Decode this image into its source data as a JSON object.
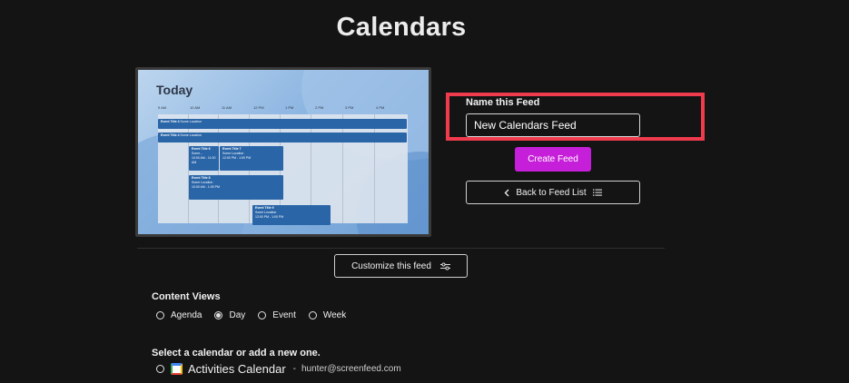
{
  "page": {
    "title": "Calendars"
  },
  "preview": {
    "heading": "Today",
    "hours": [
      "9 AM",
      "10 AM",
      "11 AM",
      "12 PM",
      "1 PM",
      "2 PM",
      "3 PM",
      "4 PM"
    ],
    "events": [
      {
        "title": "Event Title 3",
        "sub": "Some Location"
      },
      {
        "title": "Event Title 4",
        "sub": "Some Location"
      },
      {
        "title": "Event Title 6",
        "sub": "Some...",
        "time": "10:00 AM - 11:00 AM"
      },
      {
        "title": "Event Title 7",
        "sub": "Some Location",
        "time": "12:00 PM - 1:00 PM"
      },
      {
        "title": "Event Title 8",
        "sub": "Some Location",
        "time": "10:00 AM - 1:00 PM"
      },
      {
        "title": "Event Title 9",
        "sub": "Some Location",
        "time": "12:00 PM - 1:00 PM"
      }
    ]
  },
  "feed_form": {
    "name_label": "Name this Feed",
    "name_value": "New Calendars Feed",
    "create_label": "Create Feed",
    "back_label": "Back to Feed List"
  },
  "customize": {
    "label": "Customize this feed"
  },
  "content_views": {
    "label": "Content Views",
    "options": [
      {
        "label": "Agenda",
        "selected": false
      },
      {
        "label": "Day",
        "selected": true
      },
      {
        "label": "Event",
        "selected": false
      },
      {
        "label": "Week",
        "selected": false
      }
    ]
  },
  "calendar_select": {
    "label": "Select a calendar or add a new one.",
    "calendars": [
      {
        "name": "Activities Calendar",
        "separator": "-",
        "email": "hunter@screenfeed.com",
        "icon": "google-calendar-icon"
      }
    ]
  },
  "colors": {
    "accent": "#c61fd9",
    "highlight_border": "#ef3b4d",
    "background": "#141414"
  }
}
